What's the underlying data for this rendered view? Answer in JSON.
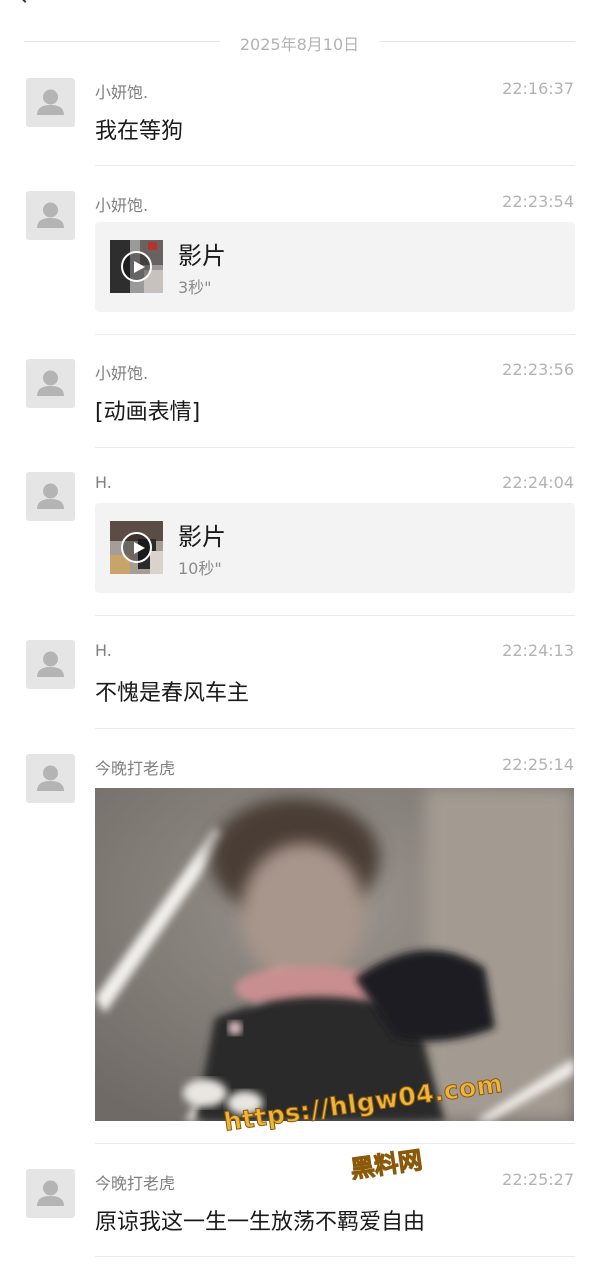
{
  "date_separator": "2025年8月10日",
  "messages": [
    {
      "sender": "小妍饱.",
      "time": "22:16:37",
      "type": "text",
      "text": "我在等狗"
    },
    {
      "sender": "小妍饱.",
      "time": "22:23:54",
      "type": "video",
      "title": "影片",
      "duration": "3秒\""
    },
    {
      "sender": "小妍饱.",
      "time": "22:23:56",
      "type": "text",
      "text": "[动画表情]"
    },
    {
      "sender": "H.",
      "time": "22:24:04",
      "type": "video",
      "title": "影片",
      "duration": "10秒\""
    },
    {
      "sender": "H.",
      "time": "22:24:13",
      "type": "text",
      "text": "不愧是春风车主"
    },
    {
      "sender": "今晚打老虎",
      "time": "22:25:14",
      "type": "image"
    },
    {
      "sender": "今晚打老虎",
      "time": "22:25:27",
      "type": "text",
      "text": "原谅我这一生一生放荡不羁爱自由"
    }
  ],
  "watermark": {
    "url": "https://hlgw04.com",
    "name": "黑料网"
  },
  "icons": {
    "avatar": "default-avatar-icon",
    "play": "play-icon",
    "back": "back-arrow-icon"
  },
  "colors": {
    "time_text": "#b3b3b3",
    "sender_text": "#808080",
    "card_bg": "#f3f3f3",
    "watermark": "#f0b43a"
  }
}
